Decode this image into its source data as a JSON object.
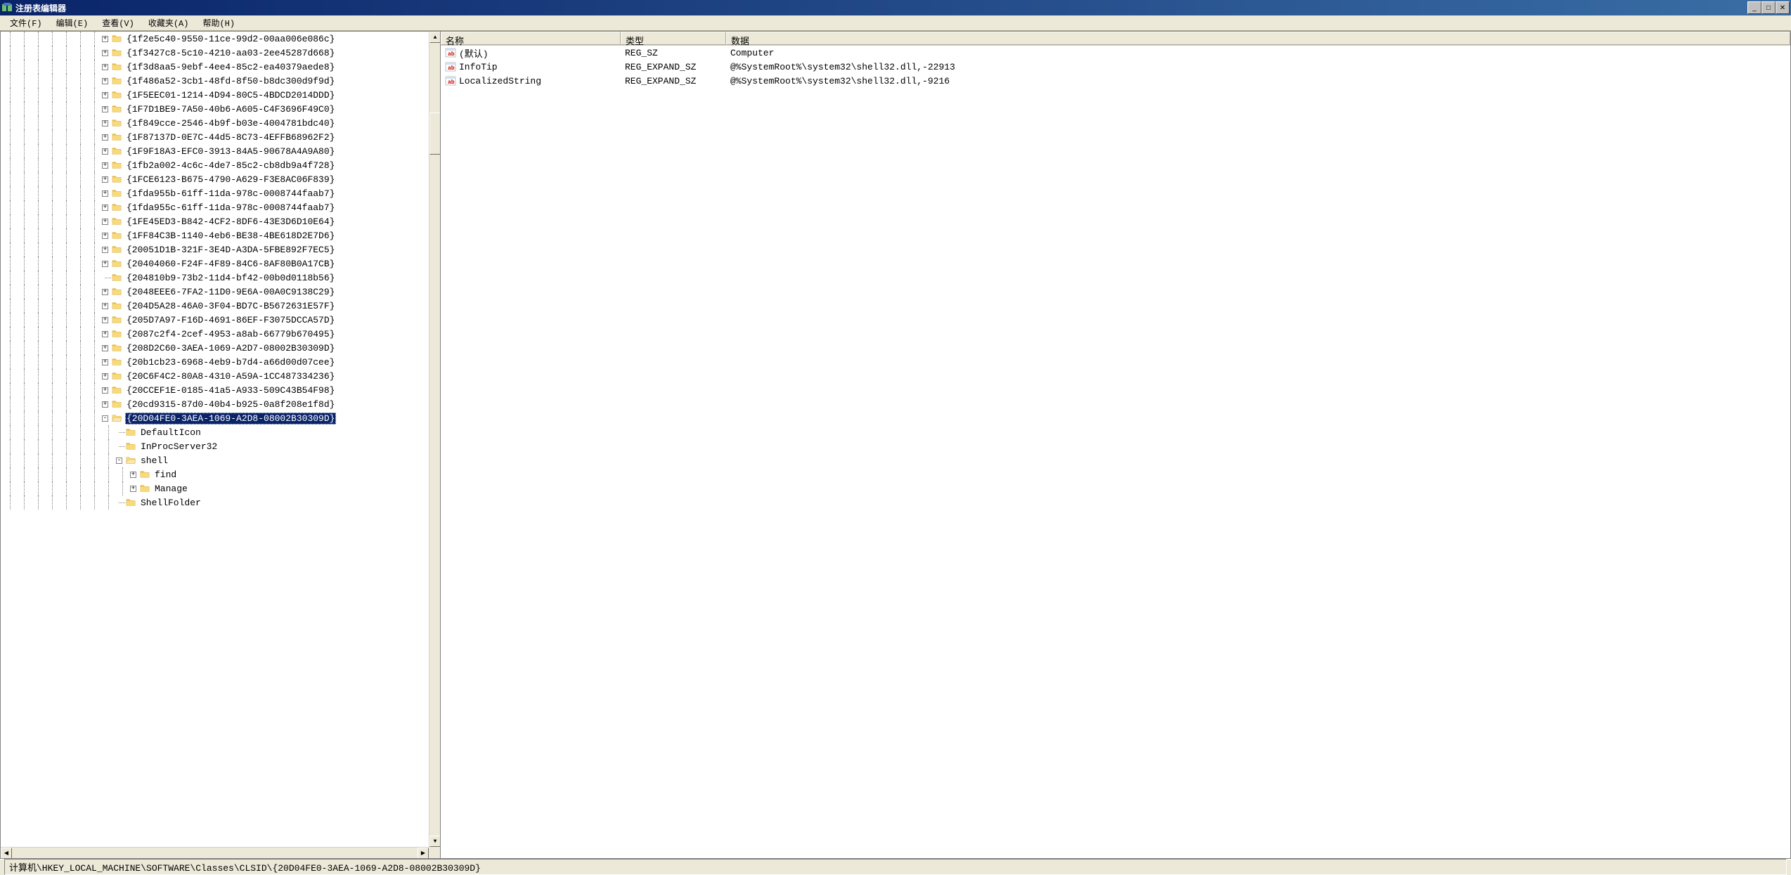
{
  "window": {
    "title": "注册表编辑器"
  },
  "menu": {
    "file": "文件(F)",
    "edit": "编辑(E)",
    "view": "查看(V)",
    "favorites": "收藏夹(A)",
    "help": "帮助(H)"
  },
  "tree": {
    "selected_label": "{20D04FE0-3AEA-1069-A2D8-08002B30309D}",
    "items": [
      {
        "depth": 7,
        "expand": "+",
        "label": "{1f2e5c40-9550-11ce-99d2-00aa006e086c}"
      },
      {
        "depth": 7,
        "expand": "+",
        "label": "{1f3427c8-5c10-4210-aa03-2ee45287d668}"
      },
      {
        "depth": 7,
        "expand": "+",
        "label": "{1f3d8aa5-9ebf-4ee4-85c2-ea40379aede8}"
      },
      {
        "depth": 7,
        "expand": "+",
        "label": "{1f486a52-3cb1-48fd-8f50-b8dc300d9f9d}"
      },
      {
        "depth": 7,
        "expand": "+",
        "label": "{1F5EEC01-1214-4D94-80C5-4BDCD2014DDD}"
      },
      {
        "depth": 7,
        "expand": "+",
        "label": "{1F7D1BE9-7A50-40b6-A605-C4F3696F49C0}"
      },
      {
        "depth": 7,
        "expand": "+",
        "label": "{1f849cce-2546-4b9f-b03e-4004781bdc40}"
      },
      {
        "depth": 7,
        "expand": "+",
        "label": "{1F87137D-0E7C-44d5-8C73-4EFFB68962F2}"
      },
      {
        "depth": 7,
        "expand": "+",
        "label": "{1F9F18A3-EFC0-3913-84A5-90678A4A9A80}"
      },
      {
        "depth": 7,
        "expand": "+",
        "label": "{1fb2a002-4c6c-4de7-85c2-cb8db9a4f728}"
      },
      {
        "depth": 7,
        "expand": "+",
        "label": "{1FCE6123-B675-4790-A629-F3E8AC06F839}"
      },
      {
        "depth": 7,
        "expand": "+",
        "label": "{1fda955b-61ff-11da-978c-0008744faab7}"
      },
      {
        "depth": 7,
        "expand": "+",
        "label": "{1fda955c-61ff-11da-978c-0008744faab7}"
      },
      {
        "depth": 7,
        "expand": "+",
        "label": "{1FE45ED3-B842-4CF2-8DF6-43E3D6D10E64}"
      },
      {
        "depth": 7,
        "expand": "+",
        "label": "{1FF84C3B-1140-4eb6-BE38-4BE618D2E7D6}"
      },
      {
        "depth": 7,
        "expand": "+",
        "label": "{20051D1B-321F-3E4D-A3DA-5FBE892F7EC5}"
      },
      {
        "depth": 7,
        "expand": "+",
        "label": "{20404060-F24F-4F89-84C6-8AF80B0A17CB}"
      },
      {
        "depth": 7,
        "expand": "",
        "label": "{204810b9-73b2-11d4-bf42-00b0d0118b56}"
      },
      {
        "depth": 7,
        "expand": "+",
        "label": "{2048EEE6-7FA2-11D0-9E6A-00A0C9138C29}"
      },
      {
        "depth": 7,
        "expand": "+",
        "label": "{204D5A28-46A0-3F04-BD7C-B5672631E57F}"
      },
      {
        "depth": 7,
        "expand": "+",
        "label": "{205D7A97-F16D-4691-86EF-F3075DCCA57D}"
      },
      {
        "depth": 7,
        "expand": "+",
        "label": "{2087c2f4-2cef-4953-a8ab-66779b670495}"
      },
      {
        "depth": 7,
        "expand": "+",
        "label": "{208D2C60-3AEA-1069-A2D7-08002B30309D}"
      },
      {
        "depth": 7,
        "expand": "+",
        "label": "{20b1cb23-6968-4eb9-b7d4-a66d00d07cee}"
      },
      {
        "depth": 7,
        "expand": "+",
        "label": "{20C6F4C2-80A8-4310-A59A-1CC487334236}"
      },
      {
        "depth": 7,
        "expand": "+",
        "label": "{20CCEF1E-0185-41a5-A933-509C43B54F98}"
      },
      {
        "depth": 7,
        "expand": "+",
        "label": "{20cd9315-87d0-40b4-b925-0a8f208e1f8d}"
      },
      {
        "depth": 7,
        "expand": "-",
        "label": "{20D04FE0-3AEA-1069-A2D8-08002B30309D}",
        "selected": true
      },
      {
        "depth": 8,
        "expand": "",
        "label": "DefaultIcon"
      },
      {
        "depth": 8,
        "expand": "",
        "label": "InProcServer32"
      },
      {
        "depth": 8,
        "expand": "-",
        "label": "shell"
      },
      {
        "depth": 9,
        "expand": "+",
        "label": "find"
      },
      {
        "depth": 9,
        "expand": "+",
        "label": "Manage"
      },
      {
        "depth": 8,
        "expand": "",
        "label": "ShellFolder",
        "truncated": true
      }
    ]
  },
  "list": {
    "columns": {
      "name": "名称",
      "type": "类型",
      "data": "数据"
    },
    "rows": [
      {
        "name": "(默认)",
        "type": "REG_SZ",
        "data": "Computer"
      },
      {
        "name": "InfoTip",
        "type": "REG_EXPAND_SZ",
        "data": "@%SystemRoot%\\system32\\shell32.dll,-22913"
      },
      {
        "name": "LocalizedString",
        "type": "REG_EXPAND_SZ",
        "data": "@%SystemRoot%\\system32\\shell32.dll,-9216"
      }
    ]
  },
  "statusbar": {
    "path": "计算机\\HKEY_LOCAL_MACHINE\\SOFTWARE\\Classes\\CLSID\\{20D04FE0-3AEA-1069-A2D8-08002B30309D}"
  }
}
